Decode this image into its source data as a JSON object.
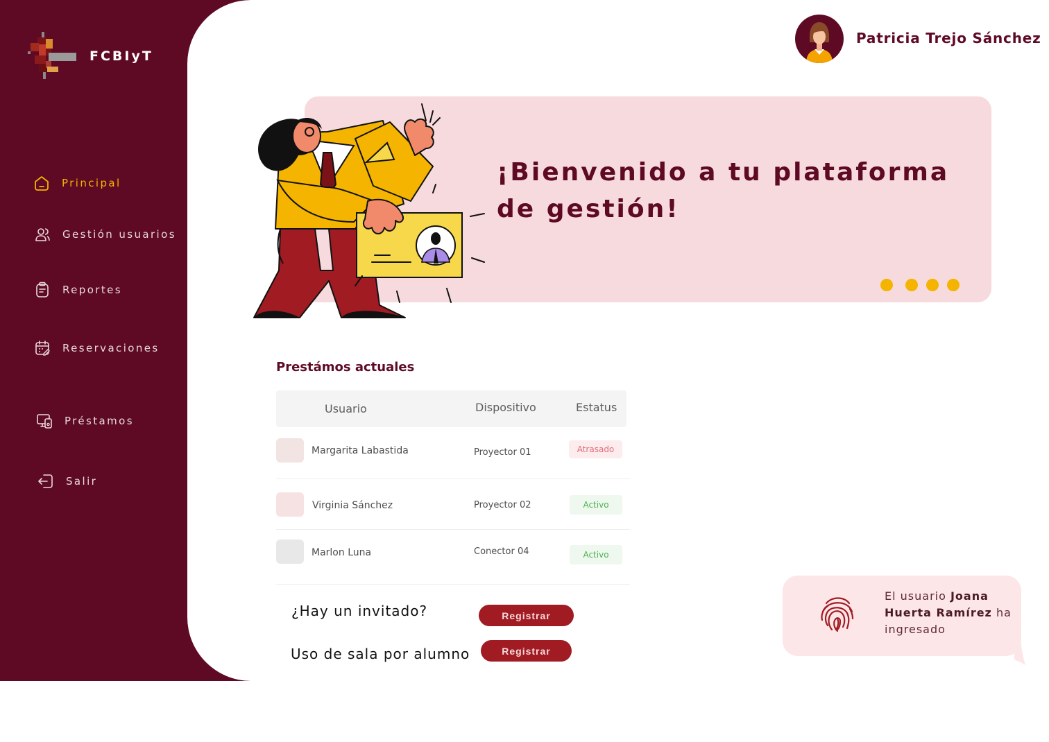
{
  "brand": {
    "name": "FCBIyT"
  },
  "sidebar": {
    "items": [
      {
        "label": "Principal",
        "icon": "home-icon",
        "active": true
      },
      {
        "label": "Gestión usuarios",
        "icon": "users-icon",
        "active": false
      },
      {
        "label": "Reportes",
        "icon": "clipboard-icon",
        "active": false
      },
      {
        "label": "Reservaciones",
        "icon": "calendar-icon",
        "active": false
      },
      {
        "label": "Préstamos",
        "icon": "devices-icon",
        "active": false
      },
      {
        "label": "Salir",
        "icon": "logout-icon",
        "active": false
      }
    ]
  },
  "header": {
    "user_name": "Patricia Trejo Sánchez"
  },
  "banner": {
    "title": "¡Bienvenido a tu plataforma de gestión!",
    "slides": 4
  },
  "loans": {
    "title": "Prestámos actuales",
    "columns": [
      "Usuario",
      "Dispositivo",
      "Estatus"
    ],
    "rows": [
      {
        "user": "Margarita Labastida",
        "device": "Proyector 01",
        "status": "Atrasado"
      },
      {
        "user": "Virginia Sánchez",
        "device": "Proyector 02",
        "status": "Activo"
      },
      {
        "user": "Marlon Luna",
        "device": "Conector 04",
        "status": "Activo"
      }
    ]
  },
  "actions": {
    "guest_question": "¿Hay un invitado?",
    "guest_button": "Registrar",
    "student_question": "Uso de sala por alumno",
    "student_button": "Registrar"
  },
  "notification": {
    "prefix": "El usuario",
    "user": "Joana Huerta Ramírez",
    "suffix": "ha ingresado",
    "icon": "fingerprint-icon"
  },
  "colors": {
    "primary": "#5f0a24",
    "accent": "#f4b400",
    "banner": "#f6dadd",
    "button": "#a01b22"
  }
}
